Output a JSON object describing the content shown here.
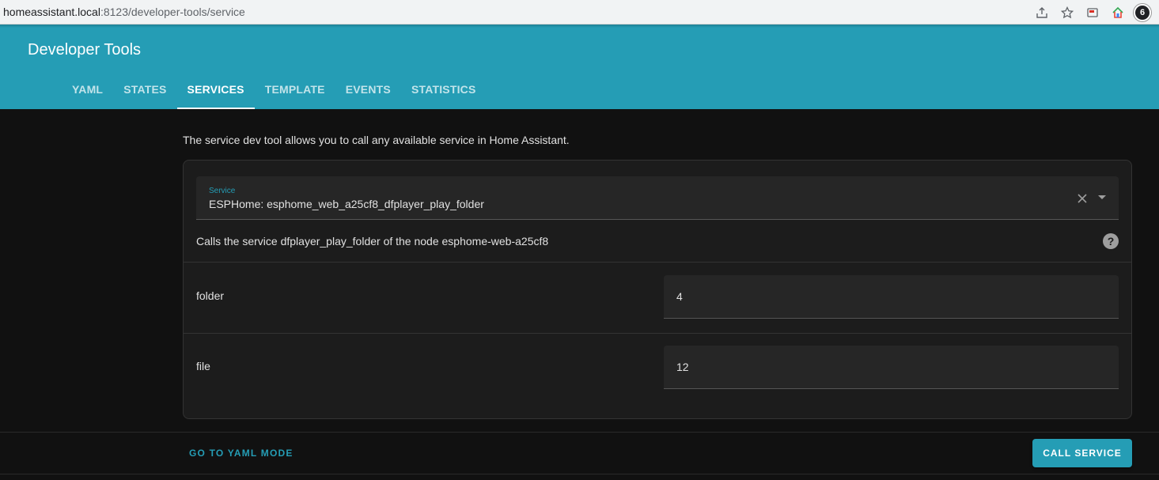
{
  "browser": {
    "url_host": "homeassistant.local",
    "url_path": ":8123/developer-tools/service",
    "icons": [
      "share-icon",
      "star-icon",
      "cast-icon",
      "home-extension-icon",
      "profile-avatar"
    ],
    "profile_initial": "6"
  },
  "header": {
    "title": "Developer Tools",
    "tabs": [
      {
        "label": "YAML",
        "active": false
      },
      {
        "label": "STATES",
        "active": false
      },
      {
        "label": "SERVICES",
        "active": true
      },
      {
        "label": "TEMPLATE",
        "active": false
      },
      {
        "label": "EVENTS",
        "active": false
      },
      {
        "label": "STATISTICS",
        "active": false
      }
    ]
  },
  "main": {
    "intro": "The service dev tool allows you to call any available service in Home Assistant.",
    "service": {
      "label": "Service",
      "value": "ESPHome: esphome_web_a25cf8_dfplayer_play_folder"
    },
    "description": "Calls the service dfplayer_play_folder of the node esphome-web-a25cf8",
    "params": [
      {
        "name": "folder",
        "value": "4"
      },
      {
        "name": "file",
        "value": "12"
      }
    ]
  },
  "footer": {
    "yaml_mode_label": "GO TO YAML MODE",
    "call_service_label": "CALL SERVICE"
  },
  "colors": {
    "accent": "#259db5",
    "background": "#111111",
    "card": "#1c1c1c"
  }
}
